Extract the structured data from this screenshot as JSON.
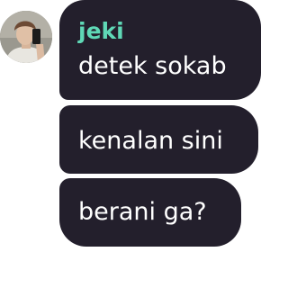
{
  "chat": {
    "avatar_icon": "user-photo-avatar",
    "sender_name": "jeki",
    "sender_color": "#5fd8b6",
    "bubble_color": "#231f2c",
    "messages": [
      {
        "text": "detek sokab"
      },
      {
        "text": "kenalan sini"
      },
      {
        "text": "berani ga?"
      }
    ]
  }
}
